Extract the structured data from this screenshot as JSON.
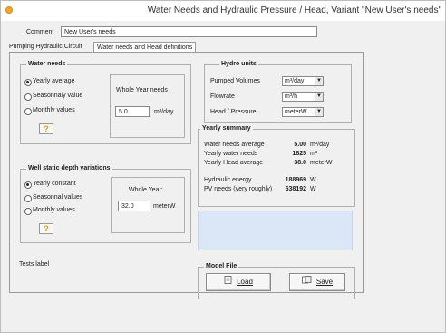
{
  "window": {
    "title": "Water Needs and Hydraulic Pressure / Head, Variant  \"New User's needs\""
  },
  "comment": {
    "label": "Comment",
    "value": "New User's needs"
  },
  "tabs": [
    {
      "label": "Pumping Hydraulic Circuit",
      "active": false
    },
    {
      "label": "Water needs and Head definitions",
      "active": true
    }
  ],
  "water_needs": {
    "title": "Water needs",
    "options": [
      "Yearly average",
      "Seasonnaly value",
      "Monthly values"
    ],
    "selected": 0,
    "sub_label": "Whole Year needs :",
    "value": "5.0",
    "unit": "m³/day",
    "help": "?"
  },
  "hydro_units": {
    "title": "Hydro units",
    "rows": [
      {
        "label": "Pumped Volumes",
        "value": "m³/day"
      },
      {
        "label": "Flowrate",
        "value": "m³/h"
      },
      {
        "label": "Head / Pressure",
        "value": "meterW"
      }
    ]
  },
  "yearly_summary": {
    "title": "Yearly summary",
    "rows": [
      {
        "label": "Water needs average",
        "value": "5.00",
        "unit": "m³/day"
      },
      {
        "label": "Yearly water needs",
        "value": "1825",
        "unit": "m³"
      },
      {
        "label": "Yearly Head average",
        "value": "38.0",
        "unit": "meterW"
      },
      {
        "label": "Hydraulic energy",
        "value": "188969",
        "unit": "W"
      },
      {
        "label": "PV needs (very roughly)",
        "value": "638192",
        "unit": "W"
      }
    ]
  },
  "static_depth": {
    "title": "Well static depth variations",
    "options": [
      "Yearly constant",
      "Seasonnal values",
      "Monthly values"
    ],
    "selected": 0,
    "sub_label": "Whole Year:",
    "value": "32.0",
    "unit": "meterW",
    "help": "?"
  },
  "tests_label": "Tests label",
  "model_file": {
    "title": "Model File",
    "load": "Load",
    "save": "Save"
  },
  "colors": {
    "accent_blue_box": "#dbe7f6",
    "help_icon": "#e0a000",
    "title_icon": "#f3a82c"
  }
}
